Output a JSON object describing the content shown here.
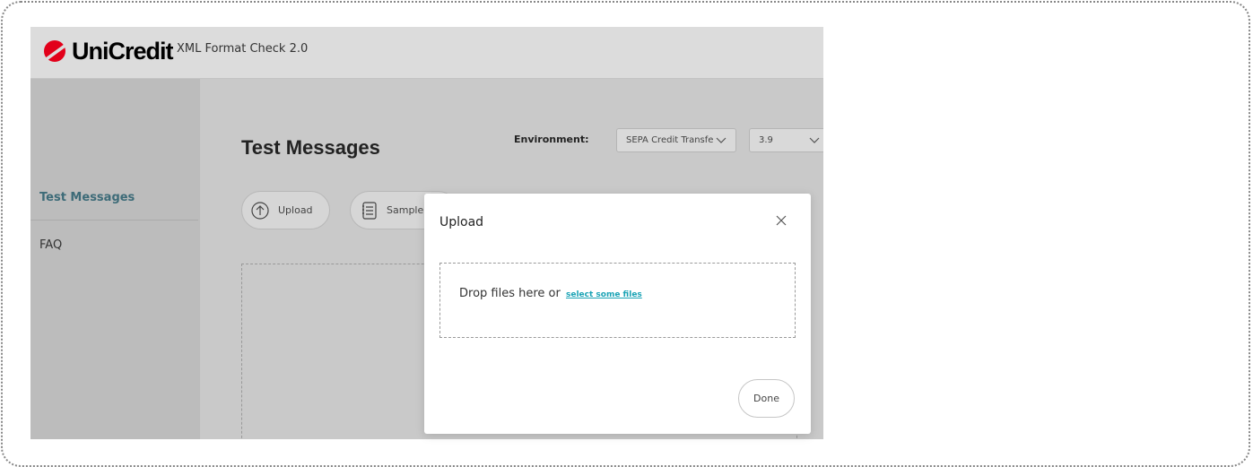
{
  "header": {
    "brand": "UniCredit",
    "app_title": "XML Format Check 2.0"
  },
  "sidebar": {
    "items": [
      {
        "label": "Test Messages",
        "active": true
      },
      {
        "label": "FAQ",
        "active": false
      }
    ]
  },
  "main": {
    "title": "Test Messages",
    "environment_label": "Environment:",
    "environment_value": "SEPA Credit Transfe",
    "version_value": "3.9",
    "buttons": {
      "upload": "Upload",
      "sample": "Sample"
    }
  },
  "modal": {
    "title": "Upload",
    "drop_text": "Drop files here or",
    "select_link": "select some files",
    "done_label": "Done"
  },
  "colors": {
    "brand_red": "#e2001a",
    "accent_teal": "#1aa3b5",
    "active_nav": "#3d6b78"
  }
}
